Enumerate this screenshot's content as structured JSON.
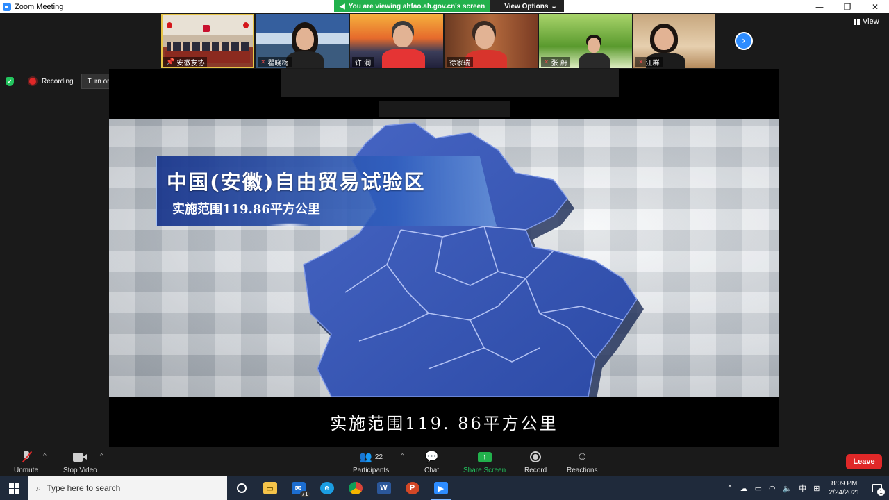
{
  "window": {
    "title": "Zoom Meeting",
    "minimize": "—",
    "restore": "❐",
    "close": "✕"
  },
  "share_banner": {
    "text": "You are viewing ahfao.ah.gov.cn's screen",
    "view_options": "View Options",
    "color": "#22b14c"
  },
  "participants": [
    {
      "name": "安徽友协",
      "icon": "pin-icon",
      "active": true
    },
    {
      "name": "瞿晓梅",
      "icon": "muted-mic-icon"
    },
    {
      "name": "许 润",
      "icon": "none"
    },
    {
      "name": "徐家瑞",
      "icon": "none"
    },
    {
      "name": "张 蔚",
      "icon": "muted-mic-icon"
    },
    {
      "name": "江群",
      "icon": "muted-mic-icon"
    }
  ],
  "view_button": "View",
  "recording": {
    "label": "Recording",
    "original_sound": "Turn on Original Sound"
  },
  "shared_content": {
    "title": "中国(安徽)自由贸易试验区",
    "subtitle_in_panel": "实施范围119.86平方公里",
    "caption": "实施范围119. 86平方公里"
  },
  "toolbar": {
    "unmute": "Unmute",
    "stop_video": "Stop Video",
    "participants": "Participants",
    "participants_count": "22",
    "chat": "Chat",
    "share_screen": "Share Screen",
    "record": "Record",
    "reactions": "Reactions",
    "leave": "Leave",
    "leave_color": "#e02828",
    "share_color": "#22b14c"
  },
  "taskbar": {
    "search_placeholder": "Type here to search",
    "mail_badge": "71",
    "ime": "中",
    "time": "8:09 PM",
    "date": "2/24/2021",
    "notification_count": "1"
  }
}
